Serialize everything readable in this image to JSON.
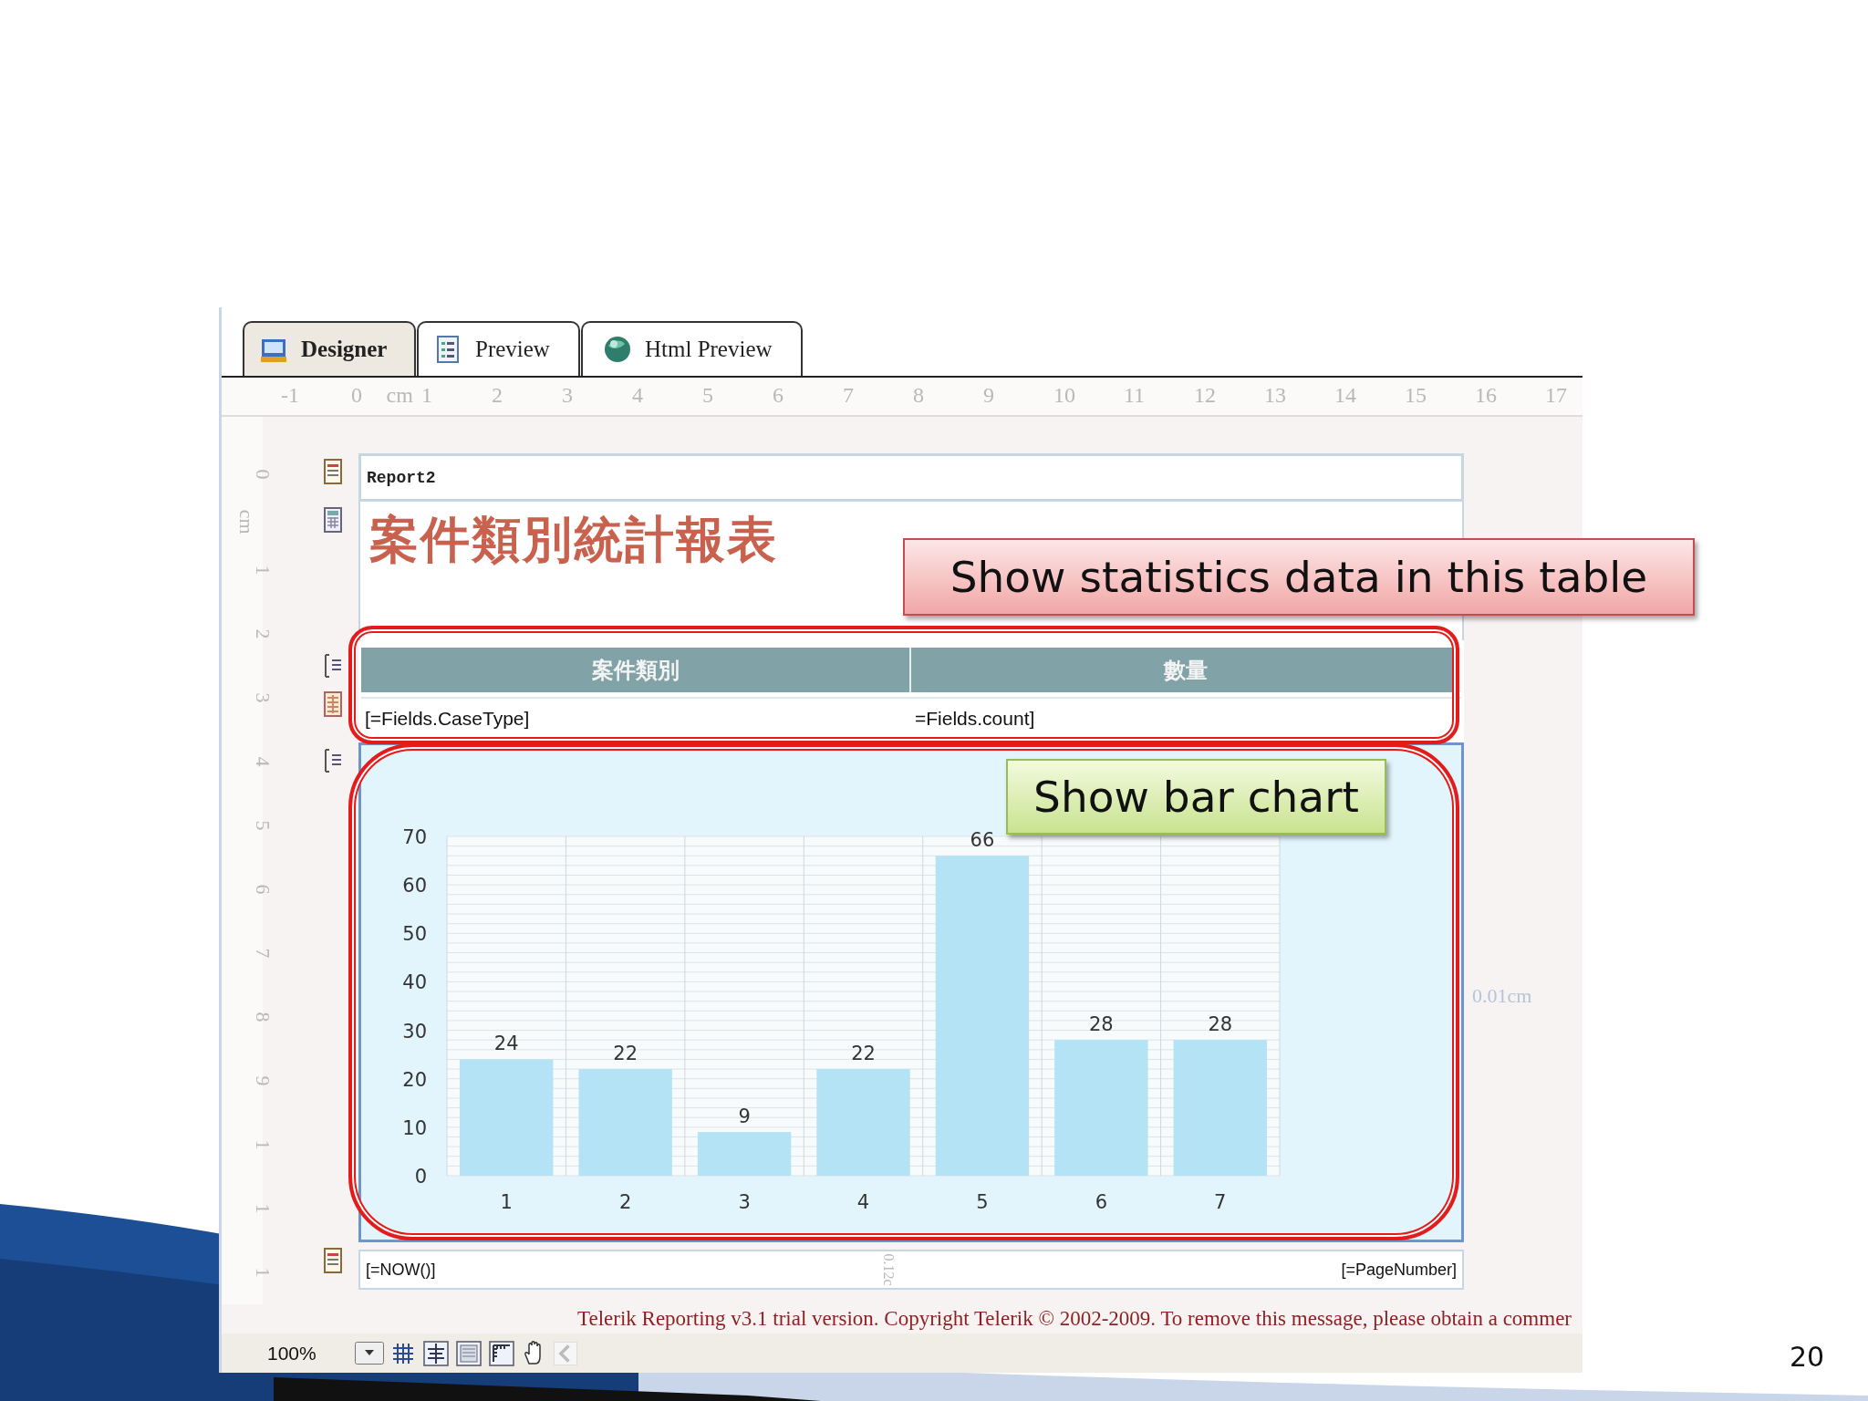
{
  "tabs": [
    {
      "label": "Designer",
      "selected": true,
      "kind": "designer"
    },
    {
      "label": "Preview",
      "selected": false,
      "kind": "preview"
    },
    {
      "label": "Html Preview",
      "selected": false,
      "kind": "html"
    }
  ],
  "top_ruler": [
    {
      "text": "-1",
      "kind": "mark"
    },
    {
      "text": "0",
      "kind": "mark"
    },
    {
      "text": "cm",
      "kind": "unit"
    },
    {
      "text": "1",
      "kind": "mark"
    },
    {
      "text": "2",
      "kind": "mark"
    },
    {
      "text": "3",
      "kind": "mark"
    },
    {
      "text": "4",
      "kind": "mark"
    },
    {
      "text": "5",
      "kind": "mark"
    },
    {
      "text": "6",
      "kind": "mark"
    },
    {
      "text": "7",
      "kind": "mark"
    },
    {
      "text": "8",
      "kind": "mark"
    },
    {
      "text": "9",
      "kind": "mark"
    },
    {
      "text": "10",
      "kind": "mark"
    },
    {
      "text": "11",
      "kind": "mark"
    },
    {
      "text": "12",
      "kind": "mark"
    },
    {
      "text": "13",
      "kind": "mark"
    },
    {
      "text": "14",
      "kind": "mark"
    },
    {
      "text": "15",
      "kind": "mark"
    },
    {
      "text": "16",
      "kind": "mark"
    },
    {
      "text": "17",
      "kind": "mark"
    }
  ],
  "left_ruler": [
    {
      "text": "0",
      "kind": "mark"
    },
    {
      "text": "cm",
      "kind": "unit"
    },
    {
      "text": "1",
      "kind": "mark"
    },
    {
      "text": "2",
      "kind": "mark"
    },
    {
      "text": "3",
      "kind": "mark"
    },
    {
      "text": "4",
      "kind": "mark"
    },
    {
      "text": "5",
      "kind": "mark"
    },
    {
      "text": "6",
      "kind": "mark"
    },
    {
      "text": "7",
      "kind": "mark"
    },
    {
      "text": "8",
      "kind": "mark"
    },
    {
      "text": "9",
      "kind": "mark"
    },
    {
      "text": "1",
      "kind": "mark"
    },
    {
      "text": "1",
      "kind": "mark"
    },
    {
      "text": "1",
      "kind": "mark"
    }
  ],
  "report": {
    "page_header": "Report2",
    "title": "案件類別統計報表",
    "table": {
      "columns": [
        "案件類別",
        "數量"
      ],
      "row": [
        "[=Fields.CaseType]",
        "=Fields.count]"
      ]
    },
    "chart": {
      "side_label": "0.01cm",
      "chart_data": {
        "type": "bar",
        "categories": [
          "1",
          "2",
          "3",
          "4",
          "5",
          "6",
          "7"
        ],
        "values": [
          24,
          22,
          9,
          22,
          66,
          28,
          28
        ],
        "color": "#b3e3f4",
        "grid": true,
        "ylim": [
          0,
          70
        ],
        "yticks": [
          0,
          10,
          20,
          30,
          40,
          50,
          60,
          70
        ],
        "data_labels": true
      }
    },
    "footer": {
      "left": "[=NOW()]",
      "center": "0.12c",
      "right": "[=PageNumber]"
    }
  },
  "trial_message": "Telerik Reporting v3.1 trial version. Copyright Telerik © 2002-2009. To remove this message, please obtain a commer",
  "toolbar": {
    "zoom": "100%"
  },
  "callouts": [
    {
      "text": "Show statistics data in this table",
      "kind": "warning"
    },
    {
      "text": "Show bar chart",
      "kind": "note"
    }
  ],
  "page_number": "20"
}
